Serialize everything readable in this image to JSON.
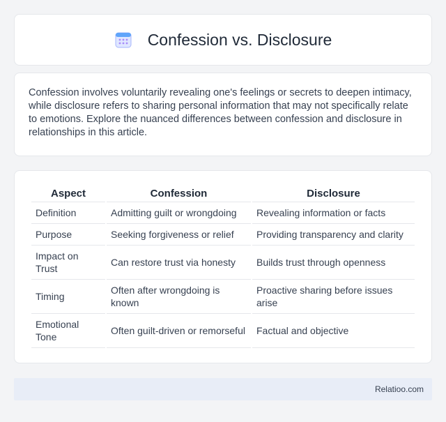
{
  "header": {
    "title": "Confession vs. Disclosure",
    "icon": "calendar-icon"
  },
  "intro": {
    "text": "Confession involves voluntarily revealing one's feelings or secrets to deepen intimacy, while disclosure refers to sharing personal information that may not specifically relate to emotions. Explore the nuanced differences between confession and disclosure in relationships in this article."
  },
  "table": {
    "headers": [
      "Aspect",
      "Confession",
      "Disclosure"
    ],
    "rows": [
      [
        "Definition",
        "Admitting guilt or wrongdoing",
        "Revealing information or facts"
      ],
      [
        "Purpose",
        "Seeking forgiveness or relief",
        "Providing transparency and clarity"
      ],
      [
        "Impact on Trust",
        "Can restore trust via honesty",
        "Builds trust through openness"
      ],
      [
        "Timing",
        "Often after wrongdoing is known",
        "Proactive sharing before issues arise"
      ],
      [
        "Emotional Tone",
        "Often guilt-driven or remorseful",
        "Factual and objective"
      ]
    ]
  },
  "footer": {
    "brand": "Relatioo.com"
  }
}
